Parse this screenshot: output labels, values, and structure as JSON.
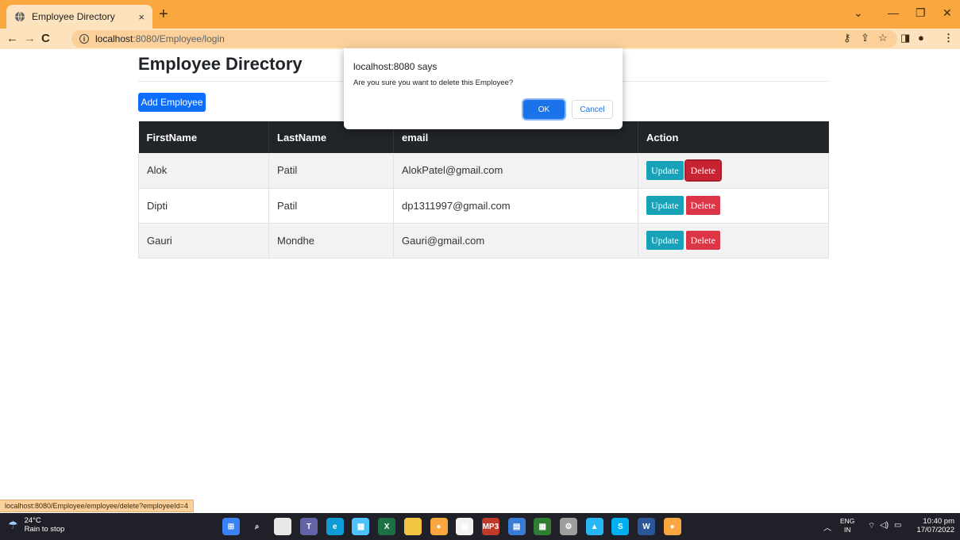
{
  "browser": {
    "tab_title": "Employee Directory",
    "tab_close": "×",
    "new_tab": "+",
    "url_host": "localhost",
    "url_path": ":8080/Employee/login",
    "status_url": "localhost:8080/Employee/employee/delete?employeeId=4",
    "controls": {
      "minimize": "—",
      "restore": "❐",
      "close": "✕",
      "dropdown": "⌄"
    }
  },
  "page": {
    "title": "Employee Directory",
    "add_button": "Add Employee",
    "table": {
      "headers": [
        "FirstName",
        "LastName",
        "email",
        "Action"
      ],
      "rows": [
        {
          "first": "Alok",
          "last": "Patil",
          "email": "AlokPatel@gmail.com",
          "update": "Update",
          "delete": "Delete"
        },
        {
          "first": "Dipti",
          "last": "Patil",
          "email": "dp1311997@gmail.com",
          "update": "Update",
          "delete": "Delete"
        },
        {
          "first": "Gauri",
          "last": "Mondhe",
          "email": "Gauri@gmail.com",
          "update": "Update",
          "delete": "Delete"
        }
      ]
    }
  },
  "dialog": {
    "title": "localhost:8080 says",
    "message": "Are you sure you want to delete this Employee?",
    "ok": "OK",
    "cancel": "Cancel"
  },
  "taskbar": {
    "weather_temp": "24°C",
    "weather_desc": "Rain to stop",
    "lang_top": "ENG",
    "lang_bottom": "IN",
    "time": "10:40 pm",
    "date": "17/07/2022",
    "icons": [
      {
        "name": "start-icon",
        "color": "#3b82f6",
        "glyph": "⊞"
      },
      {
        "name": "search-icon",
        "color": "#202028",
        "glyph": "⌕"
      },
      {
        "name": "file-explorer-icon",
        "color": "#e8e8e8",
        "glyph": ""
      },
      {
        "name": "teams-icon",
        "color": "#6264a7",
        "glyph": "T"
      },
      {
        "name": "edge-icon",
        "color": "#0f9bd7",
        "glyph": "e"
      },
      {
        "name": "photos-icon",
        "color": "#4cc2ff",
        "glyph": "▦"
      },
      {
        "name": "excel-icon",
        "color": "#1d7044",
        "glyph": "X"
      },
      {
        "name": "folder-icon",
        "color": "#f4c542",
        "glyph": ""
      },
      {
        "name": "chrome-icon",
        "color": "#f9a73e",
        "glyph": "●"
      },
      {
        "name": "store-icon",
        "color": "#f2f2f2",
        "glyph": "▣"
      },
      {
        "name": "mp3-icon",
        "color": "#c0392b",
        "glyph": "MP3"
      },
      {
        "name": "notepad-icon",
        "color": "#3a7bd5",
        "glyph": "▤"
      },
      {
        "name": "sheet-icon",
        "color": "#2e7d32",
        "glyph": "▦"
      },
      {
        "name": "settings-icon",
        "color": "#9e9e9e",
        "glyph": "⚙"
      },
      {
        "name": "app-icon",
        "color": "#29b6f6",
        "glyph": "▲"
      },
      {
        "name": "skype-icon",
        "color": "#00aff0",
        "glyph": "S"
      },
      {
        "name": "word-icon",
        "color": "#2b579a",
        "glyph": "W"
      },
      {
        "name": "chrome-active-icon",
        "color": "#f9a73e",
        "glyph": "●"
      }
    ]
  }
}
